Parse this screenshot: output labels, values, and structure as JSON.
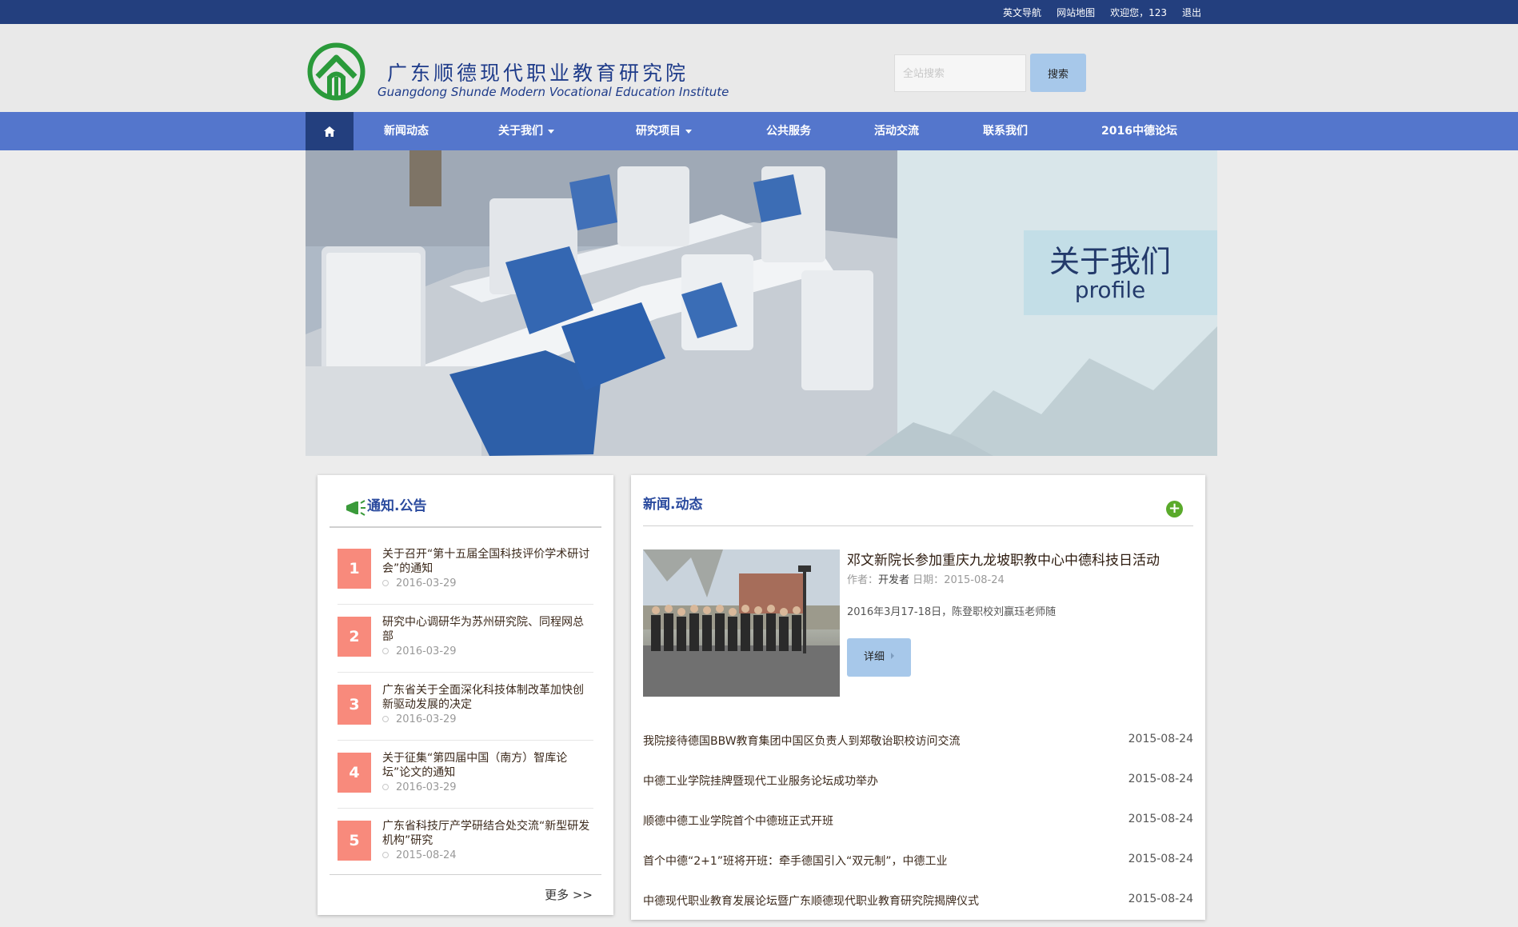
{
  "topbar": {
    "links": [
      "英文导航",
      "网站地图",
      "欢迎您，123",
      "退出"
    ]
  },
  "header": {
    "title_cn": "广东顺德现代职业教育研究院",
    "title_en": "Guangdong Shunde Modern Vocational Education Institute",
    "search_placeholder": "全站搜索",
    "search_button": "搜索"
  },
  "nav": {
    "home_icon": "home-icon",
    "items": [
      "新闻动态",
      "关于我们",
      "研究项目",
      "公共服务",
      "活动交流",
      "联系我们",
      "2016中德论坛"
    ]
  },
  "banner": {
    "title": "关于我们",
    "subtitle": "profile"
  },
  "notice": {
    "title": "通知.公告",
    "icon": "megaphone-icon",
    "items": [
      {
        "num": "1",
        "text": "关于召开“第十五届全国科技评价学术研讨会”的通知",
        "date": "2016-03-29"
      },
      {
        "num": "2",
        "text": "研究中心调研华为苏州研究院、同程网总部",
        "date": "2016-03-29"
      },
      {
        "num": "3",
        "text": "广东省关于全面深化科技体制改革加快创新驱动发展的决定",
        "date": "2016-03-29"
      },
      {
        "num": "4",
        "text": "关于征集“第四届中国（南方）智库论坛”论文的通知",
        "date": "2016-03-29"
      },
      {
        "num": "5",
        "text": "广东省科技厅产学研结合处交流“新型研发机构”研究",
        "date": "2015-08-24"
      }
    ],
    "more": "更多 >>"
  },
  "news": {
    "title": "新闻.动态",
    "feature": {
      "title": "邓文新院长参加重庆九龙坡职教中心中德科技日活动",
      "author_label": "作者：",
      "author": "开发者",
      "date_label": "日期：",
      "date": "2015-08-24",
      "desc": "2016年3月17-18日，陈登职校刘赢珏老师随",
      "button": "详细"
    },
    "items": [
      {
        "title": "我院接待德国BBW教育集团中国区负责人到郑敬诒职校访问交流",
        "date": "2015-08-24"
      },
      {
        "title": "中德工业学院挂牌暨现代工业服务论坛成功举办",
        "date": "2015-08-24"
      },
      {
        "title": "顺德中德工业学院首个中德班正式开班",
        "date": "2015-08-24"
      },
      {
        "title": "首个中德“2+1”班将开班：牵手德国引入“双元制”，中德工业",
        "date": "2015-08-24"
      },
      {
        "title": "中德现代职业教育发展论坛暨广东顺德现代职业教育研究院揭牌仪式",
        "date": "2015-08-24"
      }
    ]
  }
}
